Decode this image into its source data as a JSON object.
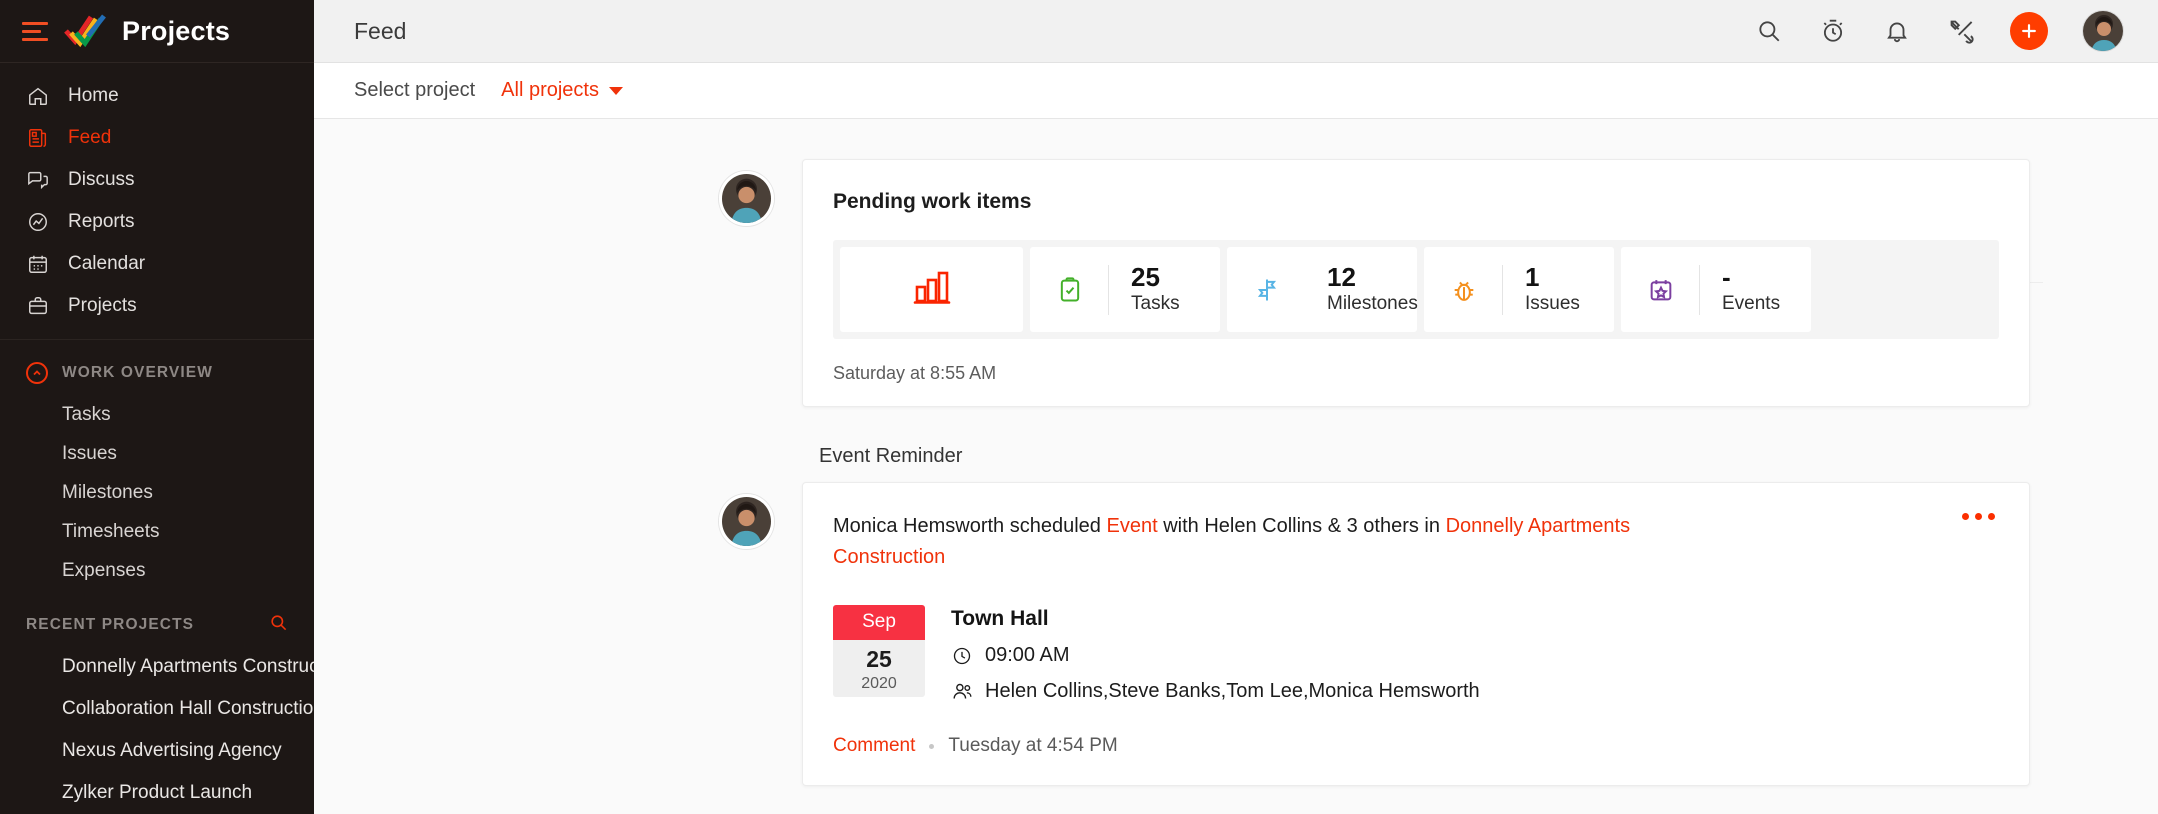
{
  "brand": {
    "title": "Projects",
    "menu_icon": "hamburger-icon",
    "logo_icon": "zoho-projects-logo"
  },
  "sidebar": {
    "nav": [
      {
        "label": "Home",
        "icon": "home-icon",
        "active": false
      },
      {
        "label": "Feed",
        "icon": "feed-icon",
        "active": true
      },
      {
        "label": "Discuss",
        "icon": "discuss-icon",
        "active": false
      },
      {
        "label": "Reports",
        "icon": "reports-icon",
        "active": false
      },
      {
        "label": "Calendar",
        "icon": "calendar-icon",
        "active": false
      },
      {
        "label": "Projects",
        "icon": "projects-icon",
        "active": false
      }
    ],
    "work_overview": {
      "title": "WORK OVERVIEW",
      "collapse_icon": "chevron-up-icon",
      "items": [
        {
          "label": "Tasks"
        },
        {
          "label": "Issues"
        },
        {
          "label": "Milestones"
        },
        {
          "label": "Timesheets"
        },
        {
          "label": "Expenses"
        }
      ]
    },
    "recent_projects": {
      "title": "RECENT PROJECTS",
      "search_icon": "search-icon",
      "items": [
        {
          "label": "Donnelly Apartments Construction"
        },
        {
          "label": "Collaboration Hall Construction"
        },
        {
          "label": "Nexus Advertising Agency"
        },
        {
          "label": "Zylker Product Launch"
        }
      ]
    }
  },
  "header": {
    "title": "Feed",
    "actions": [
      {
        "name": "search-icon"
      },
      {
        "name": "timer-icon"
      },
      {
        "name": "notification-bell-icon"
      },
      {
        "name": "tools-icon"
      }
    ],
    "add_button_label": "+",
    "avatar": "user-avatar"
  },
  "project_bar": {
    "label": "Select project",
    "selected": "All projects",
    "caret_icon": "chevron-down-icon"
  },
  "feed": {
    "pending_card": {
      "title": "Pending work items",
      "chart_icon": "bar-chart-icon",
      "stats": [
        {
          "value": "25",
          "label": "Tasks",
          "icon": "task-clipboard-icon",
          "color": "#43b02a"
        },
        {
          "value": "12",
          "label": "Milestones",
          "icon": "milestone-flag-icon",
          "color": "#58b4e5"
        },
        {
          "value": "1",
          "label": "Issues",
          "icon": "bug-icon",
          "color": "#f4901e"
        },
        {
          "value": "-",
          "label": "Events",
          "icon": "calendar-star-icon",
          "color": "#7b3fa0"
        }
      ],
      "timestamp": "Saturday at 8:55 AM"
    },
    "section_label": "Event Reminder",
    "event_card": {
      "actor": "Monica Hemsworth",
      "verb": "scheduled",
      "object": "Event",
      "with_text": "with Helen Collins & 3 others in",
      "project": "Donnelly Apartments Construction",
      "more_icon": "more-options-icon",
      "date": {
        "month": "Sep",
        "day": "25",
        "year": "2020"
      },
      "title": "Town Hall",
      "time": "09:00 AM",
      "time_icon": "clock-icon",
      "attendees": "Helen Collins,Steve Banks,Tom Lee,Monica Hemsworth",
      "attendees_icon": "people-icon",
      "comment_label": "Comment",
      "timestamp": "Tuesday at 4:54 PM"
    }
  },
  "colors": {
    "accent": "#f0320a",
    "add_button": "#ff3d00",
    "sidebar_bg": "#1d1715",
    "date_badge": "#f73142"
  }
}
